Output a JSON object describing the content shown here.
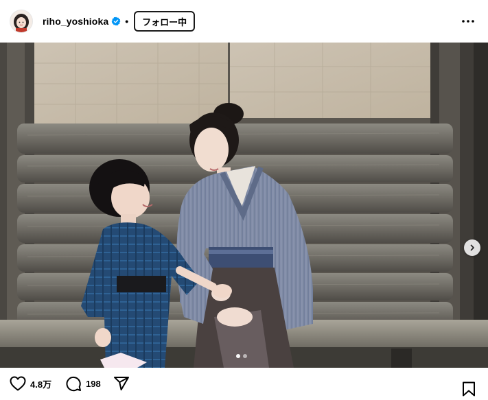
{
  "post": {
    "username": "riho_yoshioka",
    "verified": true,
    "separator": "•",
    "follow_label": "フォロー中",
    "more_icon": "more-horizontal-icon"
  },
  "carousel": {
    "total_slides": 2,
    "current_slide": 1
  },
  "actions": {
    "like_count": "4.8万",
    "comment_count": "198",
    "like_icon": "heart-icon",
    "comment_icon": "comment-bubble-icon",
    "share_icon": "paper-plane-icon",
    "save_icon": "bookmark-icon"
  },
  "colors": {
    "verified_blue": "#0095f6",
    "text": "#000000"
  }
}
